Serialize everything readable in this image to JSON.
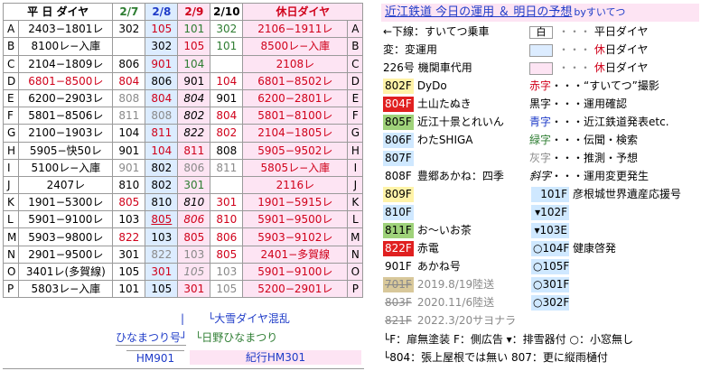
{
  "header": {
    "weekday_label": "平 日 ダイヤ",
    "dates": [
      "2/7",
      "2/8",
      "2/9",
      "2/10"
    ],
    "holiday_label": "休日ダイヤ"
  },
  "rows": [
    {
      "letter": "A",
      "wk": "2403−1801レ",
      "v": [
        "302",
        "105",
        "101",
        "302"
      ],
      "hol": "2106−1911レ"
    },
    {
      "letter": "B",
      "wk": "8100レ−入庫",
      "v": [
        "",
        "302",
        "105",
        "101"
      ],
      "hol": "8500レ−入庫"
    },
    {
      "letter": "C",
      "wk": "2104−1809レ",
      "v": [
        "806",
        "901",
        "104",
        ""
      ],
      "hol": "2108レ"
    },
    {
      "letter": "D",
      "wk": "6801−8500レ",
      "v": [
        "804",
        "806",
        "901",
        "104"
      ],
      "hol": "6801−8502レ"
    },
    {
      "letter": "E",
      "wk": "6200−2903レ",
      "v": [
        "808",
        "804",
        "804",
        "901"
      ],
      "hol": "6200−2801レ"
    },
    {
      "letter": "F",
      "wk": "5801−8506レ",
      "v": [
        "811",
        "808",
        "802",
        "804"
      ],
      "hol": "5801−8100レ"
    },
    {
      "letter": "G",
      "wk": "2100−1903レ",
      "v": [
        "104",
        "811",
        "822",
        "802"
      ],
      "hol": "2104−1805レ"
    },
    {
      "letter": "H",
      "wk": "5905−快50レ",
      "v": [
        "901",
        "104",
        "811",
        "808"
      ],
      "hol": "5905−9502レ"
    },
    {
      "letter": "I",
      "wk": "5100レ−入庫",
      "v": [
        "901",
        "802",
        "806",
        "811"
      ],
      "hol": "5805レ−入庫"
    },
    {
      "letter": "J",
      "wk": "2407レ",
      "v": [
        "810",
        "802",
        "301",
        ""
      ],
      "hol": "2116レ"
    },
    {
      "letter": "K",
      "wk": "1901−5300レ",
      "v": [
        "805",
        "810",
        "810",
        "301"
      ],
      "hol": "1901−5915レ"
    },
    {
      "letter": "L",
      "wk": "5901−9100レ",
      "v": [
        "103",
        "805",
        "806",
        "810"
      ],
      "hol": "5901−9500レ"
    },
    {
      "letter": "M",
      "wk": "5903−9800レ",
      "v": [
        "822",
        "103",
        "805",
        "806"
      ],
      "hol": "5903−9102レ"
    },
    {
      "letter": "N",
      "wk": "2901−9500レ",
      "v": [
        "301",
        "822",
        "103",
        "805"
      ],
      "hol": "2401−多賀線"
    },
    {
      "letter": "O",
      "wk": "3401レ(多賀線)",
      "v": [
        "105",
        "301",
        "105",
        "103"
      ],
      "hol": "5901−9100レ"
    },
    {
      "letter": "P",
      "wk": "5803レ−入庫",
      "v": [
        "101",
        "105",
        "301",
        "105"
      ],
      "hol": "5200−2901レ"
    }
  ],
  "notes": {
    "oyuki": "└大雪ダイヤ混乱",
    "hinamatsuri_go": "ひなまつり号┘",
    "hino_hinamatsuri": "└日野ひなまつり",
    "hm901": "HM901",
    "kiko_hm301": "紀行HM301"
  },
  "colors": {
    "pink": "#fde4f3",
    "light_blue": "#dcecff",
    "red": "#d0021b",
    "blue": "#1f3cc8",
    "green": "#2e7d32",
    "gray": "#8a8a8a",
    "chip_yellow": "#fff3a8",
    "chip_red": "#e02020",
    "chip_green": "#9fd27a",
    "chip_blue": "#cfe8ff",
    "chip_tan": "#d8c89a"
  },
  "legend": {
    "title_main": "近江鉄道 今日の運用 ＆ 明日の予想",
    "title_by": "byすいてつ",
    "underline_note": "←下線：すいてつ乗車",
    "hen": "変：変運用",
    "k226": "226号 機関車代用",
    "swatch_wk": "平日ダイヤ",
    "swatch_hol1_a": "休",
    "swatch_hol1_b": "日ダイヤ",
    "swatch_hol2_a": "休",
    "swatch_hol2_b": "日ダイヤ",
    "dots": "・・・",
    "shiro": "白",
    "trains": [
      {
        "no": "802F",
        "name": "DyDo"
      },
      {
        "no": "804F",
        "name": "土山たぬき"
      },
      {
        "no": "805F",
        "name": "近江十景とれいん"
      },
      {
        "no": "806F",
        "name": "わたSHIGA"
      },
      {
        "no": "807F",
        "name": ""
      },
      {
        "no": "808F",
        "name": "豊郷あかね：四季"
      },
      {
        "no": "809F",
        "name": ""
      },
      {
        "no": "810F",
        "name": ""
      },
      {
        "no": "811F",
        "name": "お〜いお茶"
      },
      {
        "no": "822F",
        "name": "赤電"
      },
      {
        "no": "901F",
        "name": "あかね号"
      },
      {
        "no": "701F",
        "name": "2019.8/19陸送"
      },
      {
        "no": "803F",
        "name": "2020.11/6陸送"
      },
      {
        "no": "821F",
        "name": "2022.3/20サヨナラ"
      }
    ],
    "colorkey": [
      {
        "k": "赤字",
        "v": "・・・“すいてつ”撮影"
      },
      {
        "k": "黒字",
        "v": "・・・運用確認"
      },
      {
        "k": "青字",
        "v": "・・・近江鉄道発表etc."
      },
      {
        "k": "緑字",
        "v": "・・・伝聞・検索"
      },
      {
        "k": "灰字",
        "v": "・・・推測・予想"
      },
      {
        "k": "斜字",
        "v": "・・・運用変更発生"
      }
    ],
    "ser100": [
      {
        "no": "101F",
        "name": "彦根城世界遺産応援号"
      },
      {
        "no": "▾102F",
        "name": ""
      },
      {
        "no": "▾103E",
        "name": ""
      },
      {
        "no": "○104F",
        "name": "健康啓発"
      },
      {
        "no": "○105F",
        "name": ""
      },
      {
        "no": "○301F",
        "name": ""
      },
      {
        "no": "○302F",
        "name": ""
      }
    ],
    "key_line1": "└F：扉無塗装 F：側広告 ▾：排雪器付 ○：小窓無し",
    "key_line2": "└804：張上屋根では無い 807：更に縦雨樋付"
  }
}
